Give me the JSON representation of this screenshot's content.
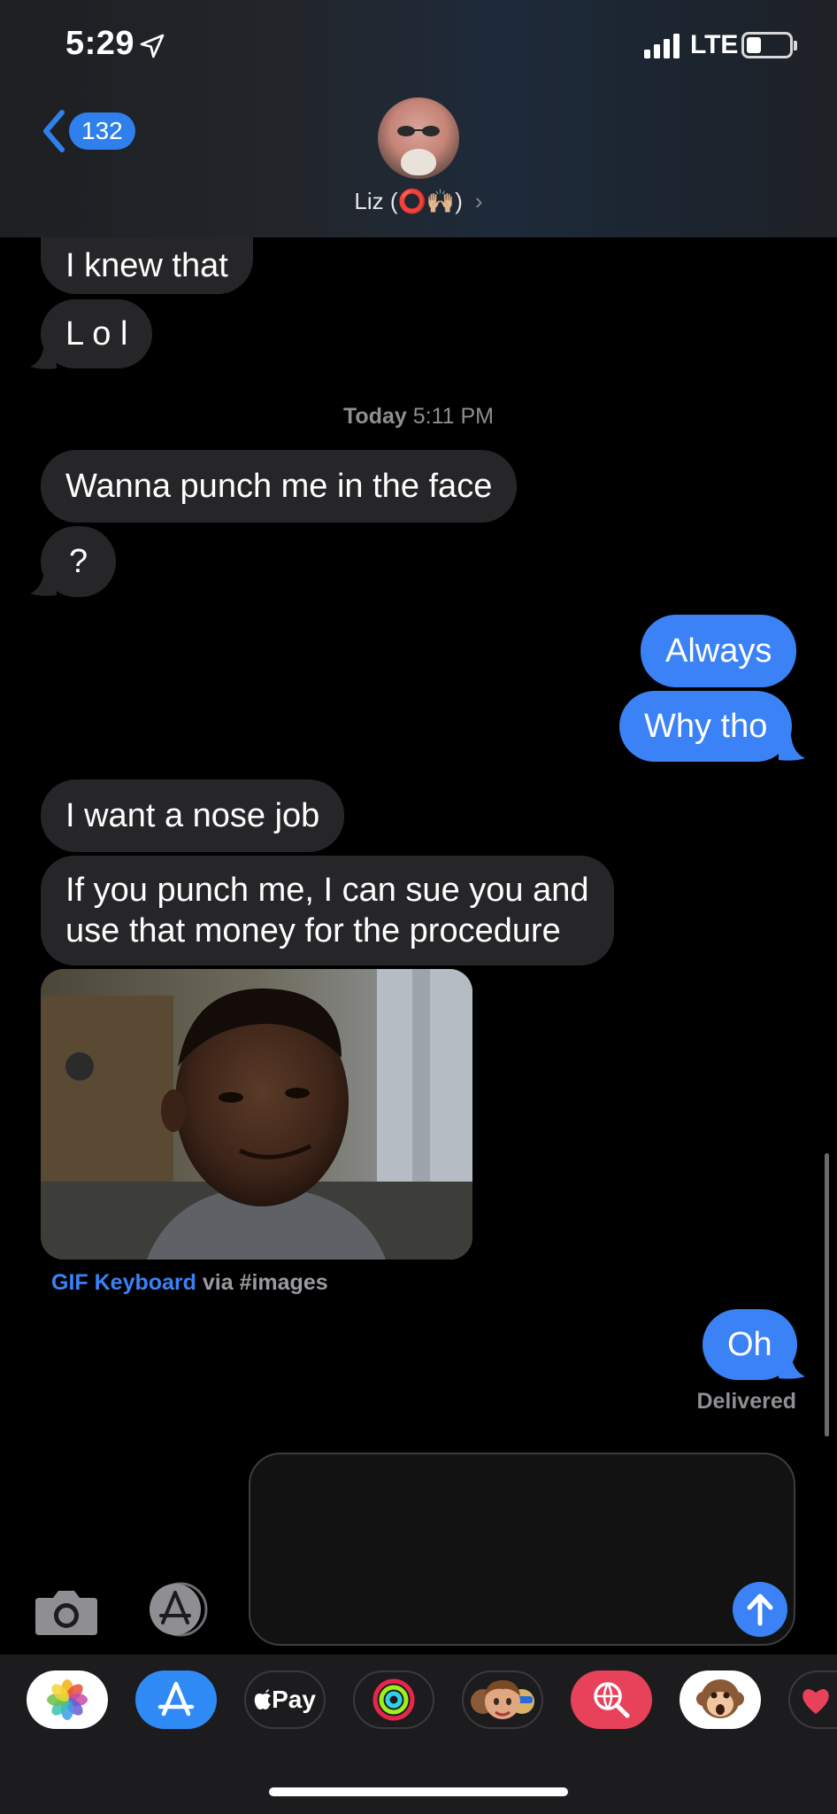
{
  "status_bar": {
    "time": "5:29",
    "network": "LTE"
  },
  "header": {
    "back_count": "132",
    "contact_name": "Liz (⭕🙌🏼)"
  },
  "messages": {
    "m1": "I knew that",
    "m2": "L o l",
    "timestamp_day": "Today",
    "timestamp_time": " 5:11 PM",
    "m3": "Wanna punch me in the face",
    "m4": "?",
    "m5": "Always",
    "m6": "Why tho",
    "m7": "I want a nose job",
    "m8_line1": "If you punch me, I can sue you and",
    "m8_line2": "use that money for the procedure",
    "gif_source": "GIF Keyboard",
    "gif_via": " via #images",
    "m9": "Oh",
    "delivered": "Delivered"
  },
  "app_drawer": {
    "items": [
      "photos-app",
      "app-store-app",
      "Pay",
      "activity-app",
      "memoji-app",
      "web-images-app",
      "animoji-app",
      "digital-touch-app"
    ]
  },
  "colors": {
    "outgoing_bubble": "#3a82f6",
    "incoming_bubble": "#262629",
    "background": "#000000"
  }
}
